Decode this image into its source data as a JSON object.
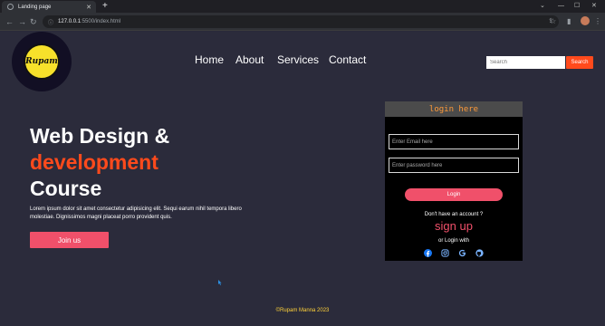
{
  "browser": {
    "tab_title": "Landing page",
    "tab_close": "✕",
    "new_tab": "+",
    "url_host": "127.0.0.1",
    "url_path": ":5500/index.html",
    "win_min": "—",
    "win_max": "☐",
    "win_close": "✕"
  },
  "nav": {
    "home": "Home",
    "about": "About",
    "services": "Services",
    "contact": "Contact"
  },
  "logo_text": "Rupam",
  "search": {
    "placeholder": "Search",
    "button": "Search"
  },
  "hero": {
    "line1": "Web Design &",
    "line2": "development",
    "line3": "Course",
    "text": "Lorem ipsum dolor sit amet consectetur adipisicing elit. Sequi earum nihil tempora libero molestiae. Dignissimos magni placeat porro provident quis.",
    "button": "Join us"
  },
  "login": {
    "title": "login here",
    "email_placeholder": "Enter Email here",
    "password_placeholder": "Enter password here",
    "button": "Login",
    "no_account": "Don't have an account ?",
    "signup": "sign up",
    "or_login": "or Login with",
    "socials": [
      "facebook-icon",
      "instagram-icon",
      "google-icon",
      "github-icon"
    ]
  },
  "footer": "©Rupam Manna 2023",
  "colors": {
    "accent": "#ff4a1c",
    "pink": "#f0506a",
    "footer": "#ffd23a",
    "bg": "#2b2b3b"
  }
}
